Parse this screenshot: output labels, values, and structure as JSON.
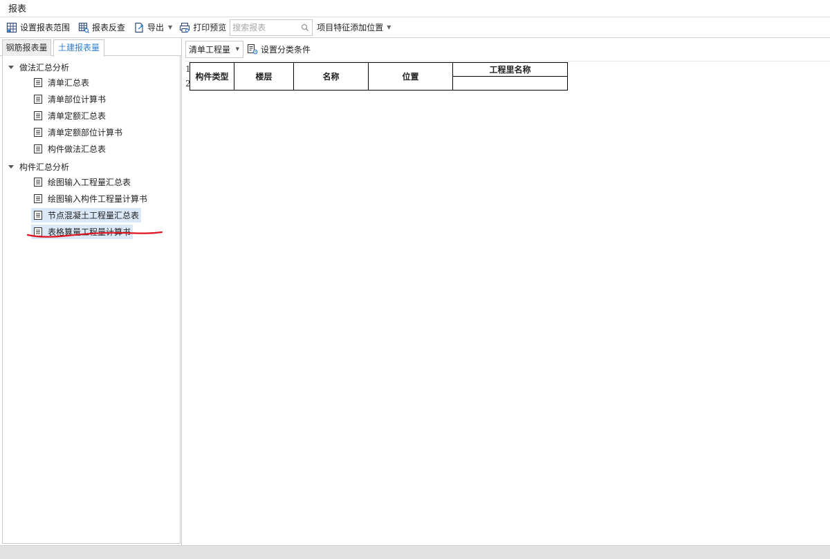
{
  "window": {
    "title": "报表"
  },
  "toolbar": {
    "set_range": "设置报表范围",
    "check": "报表反查",
    "export": "导出",
    "print_preview": "打印预览",
    "search_placeholder": "搜索报表",
    "feature_position": "项目特征添加位置"
  },
  "tabs": [
    {
      "label": "钢筋报表量",
      "active": false
    },
    {
      "label": "土建报表量",
      "active": true
    }
  ],
  "tree": {
    "group1": {
      "label": "做法汇总分析",
      "items": [
        "清单汇总表",
        "清单部位计算书",
        "清单定额汇总表",
        "清单定额部位计算书",
        "构件做法汇总表"
      ]
    },
    "group2": {
      "label": "构件汇总分析",
      "items": [
        "绘图输入工程量汇总表",
        "绘图输入构件工程量计算书",
        "节点混凝土工程量汇总表",
        "表格算量工程量计算书"
      ]
    },
    "selected_items": [
      "节点混凝土工程量汇总表",
      "表格算量工程量计算书"
    ]
  },
  "right": {
    "combo_value": "清单工程量",
    "set_condition": "设置分类条件"
  },
  "report": {
    "row_numbers": [
      "1",
      "2"
    ],
    "headers": [
      "构件类型",
      "楼层",
      "名称",
      "位置",
      "工程里名称"
    ]
  },
  "colors": {
    "accent": "#2f7fd3",
    "selection": "#dbe8f8",
    "annotation": "#e0141e"
  }
}
